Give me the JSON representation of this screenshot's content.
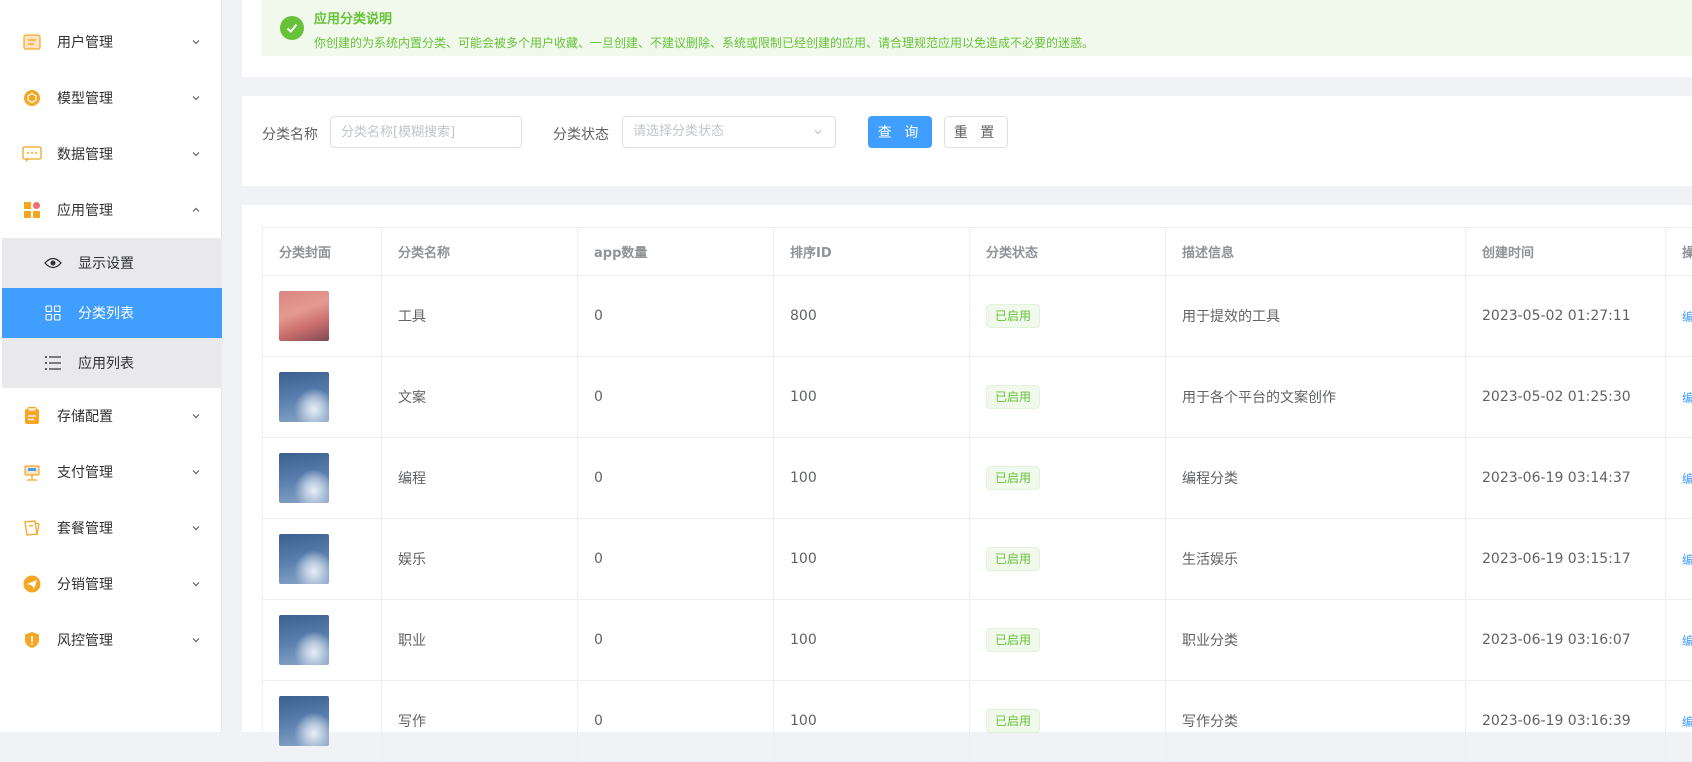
{
  "sidebar": {
    "menus": [
      {
        "key": "user",
        "label": "用户管理",
        "icon": "user-manage-icon"
      },
      {
        "key": "model",
        "label": "模型管理",
        "icon": "model-manage-icon"
      },
      {
        "key": "data",
        "label": "数据管理",
        "icon": "data-manage-icon"
      },
      {
        "key": "app",
        "label": "应用管理",
        "icon": "app-manage-icon"
      },
      {
        "key": "storage",
        "label": "存储配置",
        "icon": "storage-config-icon"
      },
      {
        "key": "pay",
        "label": "支付管理",
        "icon": "pay-manage-icon"
      },
      {
        "key": "package",
        "label": "套餐管理",
        "icon": "package-manage-icon"
      },
      {
        "key": "distribution",
        "label": "分销管理",
        "icon": "distribution-manage-icon"
      },
      {
        "key": "risk",
        "label": "风控管理",
        "icon": "risk-manage-icon"
      }
    ],
    "submenus": [
      {
        "label": "显示设置",
        "icon": "eye-icon"
      },
      {
        "label": "分类列表",
        "icon": "grid-icon",
        "active": true
      },
      {
        "label": "应用列表",
        "icon": "list-icon"
      }
    ]
  },
  "alert": {
    "title": "应用分类说明",
    "description": "你创建的为系统内置分类、可能会被多个用户收藏、一旦创建、不建议删除、系统或限制已经创建的应用、请合理规范应用以免造成不必要的迷惑。"
  },
  "filter": {
    "name_label": "分类名称",
    "name_placeholder": "分类名称[模糊搜索]",
    "status_label": "分类状态",
    "status_placeholder": "请选择分类状态",
    "query_label": "查 询",
    "reset_label": "重 置"
  },
  "table": {
    "columns": [
      "分类封面",
      "分类名称",
      "app数量",
      "排序ID",
      "分类状态",
      "描述信息",
      "创建时间",
      "操"
    ],
    "rows": [
      {
        "cover": "sunset",
        "name": "工具",
        "app_count": "0",
        "order": "800",
        "status": "已启用",
        "desc": "用于提效的工具",
        "created": "2023-05-02 01:27:11",
        "op": "编"
      },
      {
        "cover": "sky",
        "name": "文案",
        "app_count": "0",
        "order": "100",
        "status": "已启用",
        "desc": "用于各个平台的文案创作",
        "created": "2023-05-02 01:25:30",
        "op": "编"
      },
      {
        "cover": "sky",
        "name": "编程",
        "app_count": "0",
        "order": "100",
        "status": "已启用",
        "desc": "编程分类",
        "created": "2023-06-19 03:14:37",
        "op": "编"
      },
      {
        "cover": "sky",
        "name": "娱乐",
        "app_count": "0",
        "order": "100",
        "status": "已启用",
        "desc": "生活娱乐",
        "created": "2023-06-19 03:15:17",
        "op": "编"
      },
      {
        "cover": "sky",
        "name": "职业",
        "app_count": "0",
        "order": "100",
        "status": "已启用",
        "desc": "职业分类",
        "created": "2023-06-19 03:16:07",
        "op": "编"
      },
      {
        "cover": "sky",
        "name": "写作",
        "app_count": "0",
        "order": "100",
        "status": "已启用",
        "desc": "写作分类",
        "created": "2023-06-19 03:16:39",
        "op": "编"
      }
    ]
  },
  "colors": {
    "primary": "#409eff",
    "success": "#67c23a",
    "menu_icon_orange": "#f5a623"
  }
}
